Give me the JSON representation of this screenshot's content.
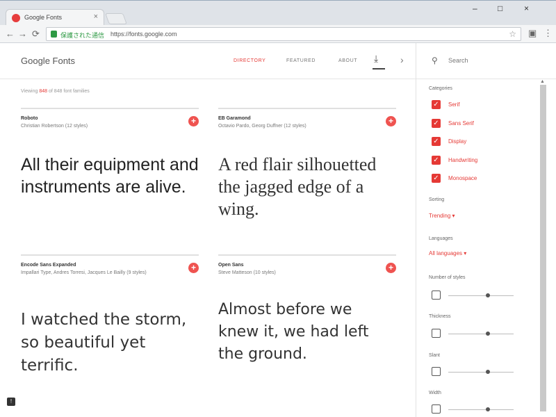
{
  "browser": {
    "tab_title": "Google Fonts",
    "tab_close": "×",
    "window_controls": [
      "–",
      "□",
      "×"
    ],
    "nav": {
      "back": "←",
      "forward": "→",
      "reload": "⟳"
    },
    "secure_label": "保護された通信",
    "url": "https://fonts.google.com",
    "star": "☆",
    "menu": "⋮"
  },
  "header": {
    "brand": "Google Fonts",
    "nav": [
      {
        "label": "DIRECTORY",
        "active": true
      },
      {
        "label": "FEATURED",
        "active": false
      },
      {
        "label": "ABOUT",
        "active": false
      }
    ],
    "download_icon": "⤓",
    "more_icon": "›"
  },
  "viewing": {
    "prefix": "Viewing ",
    "count": "848",
    "suffix": " of 848 font families"
  },
  "cards": [
    {
      "name": "Roboto",
      "meta": "Christian Robertson (12 styles)",
      "sample": "All their equipment and instruments are alive.",
      "add": "+"
    },
    {
      "name": "EB Garamond",
      "meta": "Octavio Pardo, Georg Duffner (12 styles)",
      "sample": "A red flair silhouetted the jagged edge of a wing.",
      "add": "+"
    },
    {
      "name": "Encode Sans Expanded",
      "meta": "Impallari Type, Andres Torresi, Jacques Le Bailly (9 styles)",
      "sample": "I watched the storm, so beautiful yet terrific.",
      "add": "+"
    },
    {
      "name": "Open Sans",
      "meta": "Steve Matteson (10 styles)",
      "sample": "Almost before we knew it, we had left the ground.",
      "add": "+"
    }
  ],
  "sidebar": {
    "search_icon": "⚲",
    "search_placeholder": "Search",
    "categories_title": "Categories",
    "categories": [
      {
        "label": "Serif",
        "checked": true
      },
      {
        "label": "Sans Serif",
        "checked": true
      },
      {
        "label": "Display",
        "checked": true
      },
      {
        "label": "Handwriting",
        "checked": true
      },
      {
        "label": "Monospace",
        "checked": true
      }
    ],
    "check_glyph": "✓",
    "sorting_title": "Sorting",
    "sorting_value": "Trending ▾",
    "languages_title": "Languages",
    "languages_value": "All languages ▾",
    "filters": [
      {
        "title": "Number of styles"
      },
      {
        "title": "Thickness"
      },
      {
        "title": "Slant"
      },
      {
        "title": "Width"
      }
    ],
    "scroll_up": "▲"
  },
  "feedback_icon": "!"
}
